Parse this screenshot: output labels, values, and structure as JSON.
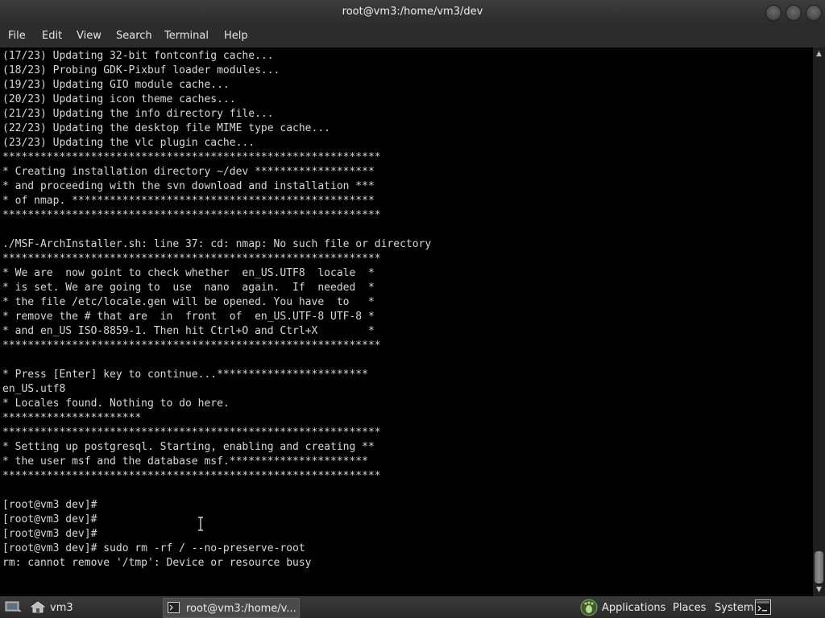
{
  "window": {
    "title": "root@vm3:/home/vm3/dev"
  },
  "menu": [
    {
      "label": "File"
    },
    {
      "label": "Edit"
    },
    {
      "label": "View"
    },
    {
      "label": "Search"
    },
    {
      "label": "Terminal"
    },
    {
      "label": "Help"
    }
  ],
  "terminal": {
    "lines": [
      "(17/23) Updating 32-bit fontconfig cache...",
      "(18/23) Probing GDK-Pixbuf loader modules...",
      "(19/23) Updating GIO module cache...",
      "(20/23) Updating icon theme caches...",
      "(21/23) Updating the info directory file...",
      "(22/23) Updating the desktop file MIME type cache...",
      "(23/23) Updating the vlc plugin cache...",
      "************************************************************",
      "* Creating installation directory ~/dev *******************",
      "* and proceeding with the svn download and installation ***",
      "* of nmap. ************************************************",
      "************************************************************",
      "",
      "./MSF-ArchInstaller.sh: line 37: cd: nmap: No such file or directory",
      "************************************************************",
      "* We are  now goint to check whether  en_US.UTF8  locale  *",
      "* is set. We are going to  use  nano  again.  If  needed  *",
      "* the file /etc/locale.gen will be opened. You have  to   *",
      "* remove the # that are  in  front  of  en_US.UTF-8 UTF-8 *",
      "* and en_US ISO-8859-1. Then hit Ctrl+O and Ctrl+X        *",
      "************************************************************",
      "",
      "* Press [Enter] key to continue...************************",
      "en_US.utf8",
      "* Locales found. Nothing to do here.",
      "**********************",
      "************************************************************",
      "* Setting up postgresql. Starting, enabling and creating **",
      "* the user msf and the database msf.**********************",
      "************************************************************",
      "",
      "[root@vm3 dev]#",
      "[root@vm3 dev]#",
      "[root@vm3 dev]#",
      "[root@vm3 dev]# sudo rm -rf / --no-preserve-root",
      "rm: cannot remove '/tmp': Device or resource busy"
    ]
  },
  "taskbar": {
    "workspace_label": "vm3",
    "task_label": "root@vm3:/home/v...",
    "applications_label": "Applications",
    "places_label": "Places",
    "system_label": "System"
  },
  "icons": {
    "window_buttons": [
      "minimize-icon",
      "maximize-icon",
      "close-icon"
    ],
    "scroll": [
      "scroll-up-icon",
      "scroll-down-icon"
    ],
    "taskbar": [
      "show-desktop-icon",
      "home-folder-icon",
      "terminal-icon",
      "gnome-foot-icon",
      "terminal-launcher-icon"
    ],
    "cursor": "text-cursor-icon"
  },
  "colors": {
    "terminal_bg": "#000000",
    "terminal_fg": "#d8d8d8",
    "chrome_bg": "#2c2c2c"
  }
}
